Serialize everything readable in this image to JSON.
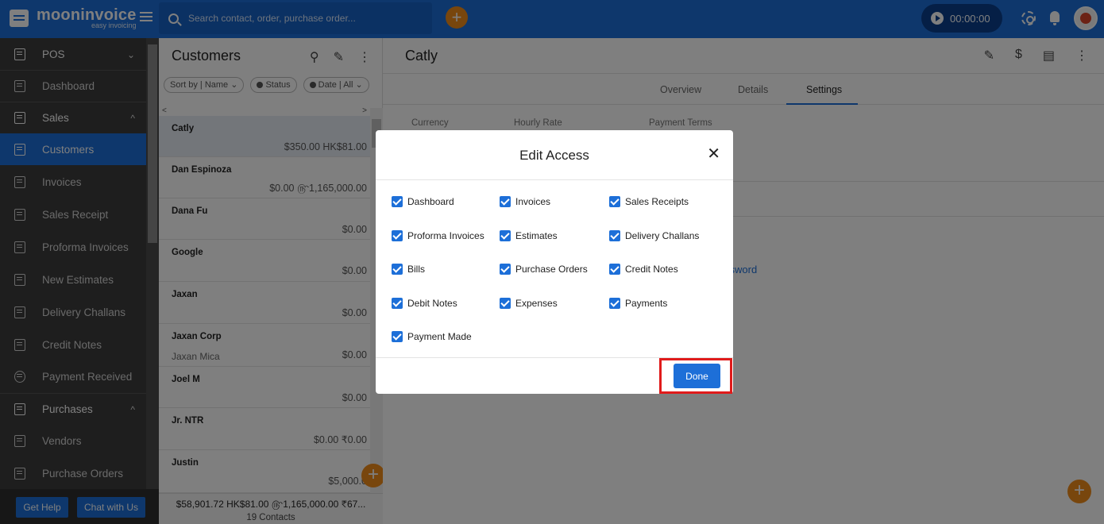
{
  "topbar": {
    "brand": "mooninvoice",
    "tagline": "easy invoicing",
    "search_placeholder": "Search contact, order, purchase order...",
    "add_label": "+",
    "timer": "00:00:00"
  },
  "sidebar": {
    "items": [
      {
        "label": "POS"
      },
      {
        "label": "Dashboard"
      },
      {
        "label": "Sales"
      },
      {
        "label": "Customers"
      },
      {
        "label": "Invoices"
      },
      {
        "label": "Sales Receipt"
      },
      {
        "label": "Proforma Invoices"
      },
      {
        "label": "New Estimates"
      },
      {
        "label": "Delivery Challans"
      },
      {
        "label": "Credit Notes"
      },
      {
        "label": "Payment Received"
      },
      {
        "label": "Purchases"
      },
      {
        "label": "Vendors"
      },
      {
        "label": "Purchase Orders"
      }
    ],
    "help_label": "Get Help",
    "chat_label": "Chat with Us"
  },
  "customers": {
    "title": "Customers",
    "filters": {
      "sort": "Sort by | Name ⌄",
      "status": "Status",
      "date": "Date | All ⌄"
    },
    "rows": [
      {
        "name": "Catly",
        "sub": "",
        "amount": "$350.00 HK$81.00"
      },
      {
        "name": "Dan Espinoza",
        "sub": "",
        "amount": "$0.00 ௹1,165,000.00"
      },
      {
        "name": "Dana Fu",
        "sub": "",
        "amount": "$0.00"
      },
      {
        "name": "Google",
        "sub": "",
        "amount": "$0.00"
      },
      {
        "name": "Jaxan",
        "sub": "",
        "amount": "$0.00"
      },
      {
        "name": "Jaxan Corp",
        "sub": "Jaxan Mica",
        "amount": "$0.00"
      },
      {
        "name": "Joel M",
        "sub": "",
        "amount": "$0.00"
      },
      {
        "name": "Jr. NTR",
        "sub": "",
        "amount": "$0.00 ₹0.00"
      },
      {
        "name": "Justin",
        "sub": "",
        "amount": "$5,000.0"
      }
    ],
    "total": "$58,901.72 HK$81.00 ௹1,165,000.00 ₹67...",
    "count": "19 Contacts"
  },
  "detail": {
    "title": "Catly",
    "tabs": [
      "Overview",
      "Details",
      "Settings"
    ],
    "labels": {
      "currency": "Currency",
      "hourly_rate": "Hourly Rate",
      "payment_terms": "Payment Terms"
    },
    "password_link": "ssword"
  },
  "modal": {
    "title": "Edit Access",
    "close": "✕",
    "options": [
      "Dashboard",
      "Invoices",
      "Sales Receipts",
      "Proforma Invoices",
      "Estimates",
      "Delivery Challans",
      "Bills",
      "Purchase Orders",
      "Credit Notes",
      "Debit Notes",
      "Expenses",
      "Payments",
      "Payment Made"
    ],
    "done_label": "Done"
  },
  "colors": {
    "brand": "#1d6fd8",
    "accent": "#f08c1a",
    "highlight": "#e01b1b"
  }
}
